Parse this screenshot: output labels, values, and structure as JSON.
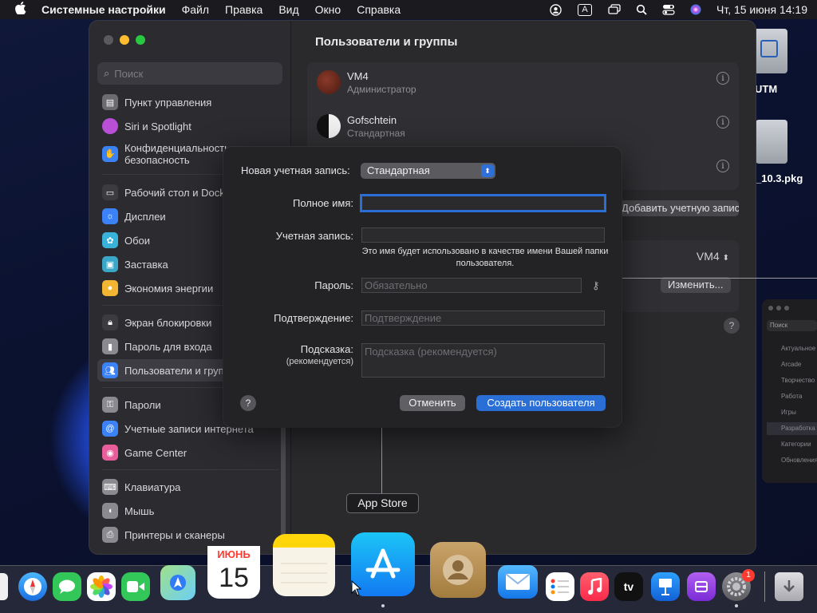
{
  "menubar": {
    "app_name": "Системные настройки",
    "items": [
      "Файл",
      "Правка",
      "Вид",
      "Окно",
      "Справка"
    ],
    "input_indicator": "A",
    "clock": "Чт, 15 июня  14:19",
    "icons": [
      "apple-icon",
      "user-icon",
      "keyboard-input-icon",
      "screen-mirroring-icon",
      "search-icon",
      "control-center-icon",
      "siri-icon"
    ]
  },
  "sidebar": {
    "search_placeholder": "Поиск",
    "items": [
      {
        "label": "Пункт управления",
        "color": "#6b6b70"
      },
      {
        "label": "Siri и Spotlight",
        "color": "#b84fd6"
      },
      {
        "label": "Конфиденциальность и безопасность",
        "color": "#3b82f6"
      },
      {
        "label": "Рабочий стол и Dock",
        "color": "#3b3b40"
      },
      {
        "label": "Дисплеи",
        "color": "#3b82f6"
      },
      {
        "label": "Обои",
        "color": "#38b2d8"
      },
      {
        "label": "Заставка",
        "color": "#3aa7c8"
      },
      {
        "label": "Экономия энергии",
        "color": "#f2b632"
      },
      {
        "label": "Экран блокировки",
        "color": "#3b3b40"
      },
      {
        "label": "Пароль для входа",
        "color": "#8a8a90"
      },
      {
        "label": "Пользователи и группы",
        "color": "#3b82f6"
      },
      {
        "label": "Пароли",
        "color": "#8a8a90"
      },
      {
        "label": "Учетные записи интернета",
        "color": "#3b82f6"
      },
      {
        "label": "Game Center",
        "color": "#e85d9a"
      },
      {
        "label": "Клавиатура",
        "color": "#8a8a90"
      },
      {
        "label": "Мышь",
        "color": "#8a8a90"
      },
      {
        "label": "Принтеры и сканеры",
        "color": "#8a8a90"
      }
    ]
  },
  "main": {
    "title": "Пользователи и группы",
    "users": [
      {
        "name": "VM4",
        "role": "Администратор"
      },
      {
        "name": "Gofschtein",
        "role": "Стандартная"
      }
    ],
    "add_account_label": "Добавить учетную запись...",
    "autologin_value": "VM4",
    "change_label": "Изменить...",
    "help": "?"
  },
  "dialog": {
    "account_type_label": "Новая учетная запись:",
    "account_type_value": "Стандартная",
    "fullname_label": "Полное имя:",
    "fullname_value": "",
    "account_label": "Учетная запись:",
    "account_value": "",
    "account_hint": "Это имя будет использовано в качестве имени Вашей папки пользователя.",
    "password_label": "Пароль:",
    "password_placeholder": "Обязательно",
    "confirm_label": "Подтверждение:",
    "confirm_placeholder": "Подтверждение",
    "hint_label": "Подсказка:",
    "hint_sublabel": "(рекомендуется)",
    "hint_placeholder": "Подсказка (рекомендуется)",
    "help": "?",
    "cancel_label": "Отменить",
    "create_label": "Создать пользователя"
  },
  "desktop": {
    "items": [
      "UTM",
      "_10.3.pkg"
    ]
  },
  "background_window": {
    "search": "Поиск",
    "items": [
      "Актуальное",
      "Arcade",
      "Творчество",
      "Работа",
      "Игры",
      "Разработка",
      "Категории",
      "Обновления"
    ],
    "active_index": 5
  },
  "tooltip": "App Store",
  "dock": {
    "calendar_month": "ИЮНЬ",
    "calendar_day": "15",
    "settings_badge": "1",
    "tv_label": "tv",
    "apps": [
      "finder-icon",
      "safari-icon",
      "messages-icon",
      "photos-icon",
      "facetime-icon",
      "maps-icon",
      "calendar-icon",
      "notes-icon",
      "app-store-icon",
      "contacts-icon",
      "mail-icon",
      "reminders-icon",
      "music-icon",
      "tv-icon",
      "keynote-icon",
      "podcasts-icon",
      "system-settings-icon",
      "downloads-icon"
    ]
  },
  "colors": {
    "accent": "#2a6fd6",
    "dialog_bg": "#232325",
    "window_bg": "#2a2a2d"
  }
}
